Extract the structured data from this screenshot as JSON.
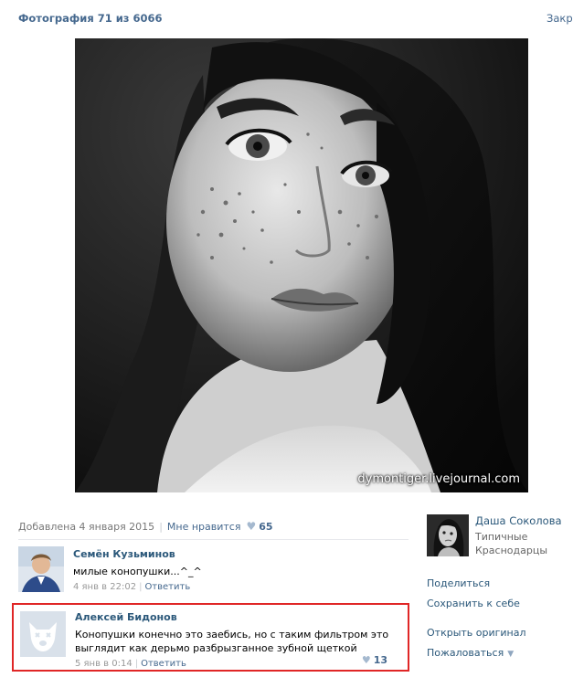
{
  "header": {
    "title": "Фотография 71 из 6066",
    "close_label": "Закрыть"
  },
  "photo": {
    "watermark": "dymontiger.livejournal.com"
  },
  "meta": {
    "added": "Добавлена 4 января 2015",
    "like_label": "Мне нравится",
    "like_count": "65"
  },
  "comments": [
    {
      "author": "Семён Кузьминов",
      "text": "милые конопушки...^_^",
      "date": "4 янв в 22:02",
      "reply_label": "Ответить"
    },
    {
      "author": "Алексей Бидонов",
      "text": "Конопушки конечно это заебись, но с таким фильтром это выглядит как дерьмо разбрызганное зубной щеткой",
      "date": "5 янв в 0:14",
      "reply_label": "Ответить",
      "likes": "13"
    }
  ],
  "owner": {
    "name": "Даша Соколова",
    "album": "Типичные Краснодарцы"
  },
  "actions": {
    "share": "Поделиться",
    "save": "Сохранить к себе",
    "original": "Открыть оригинал",
    "report": "Пожаловаться"
  },
  "colors": {
    "link": "#2b587a",
    "title": "#45688e",
    "highlight_border": "#e02626"
  }
}
